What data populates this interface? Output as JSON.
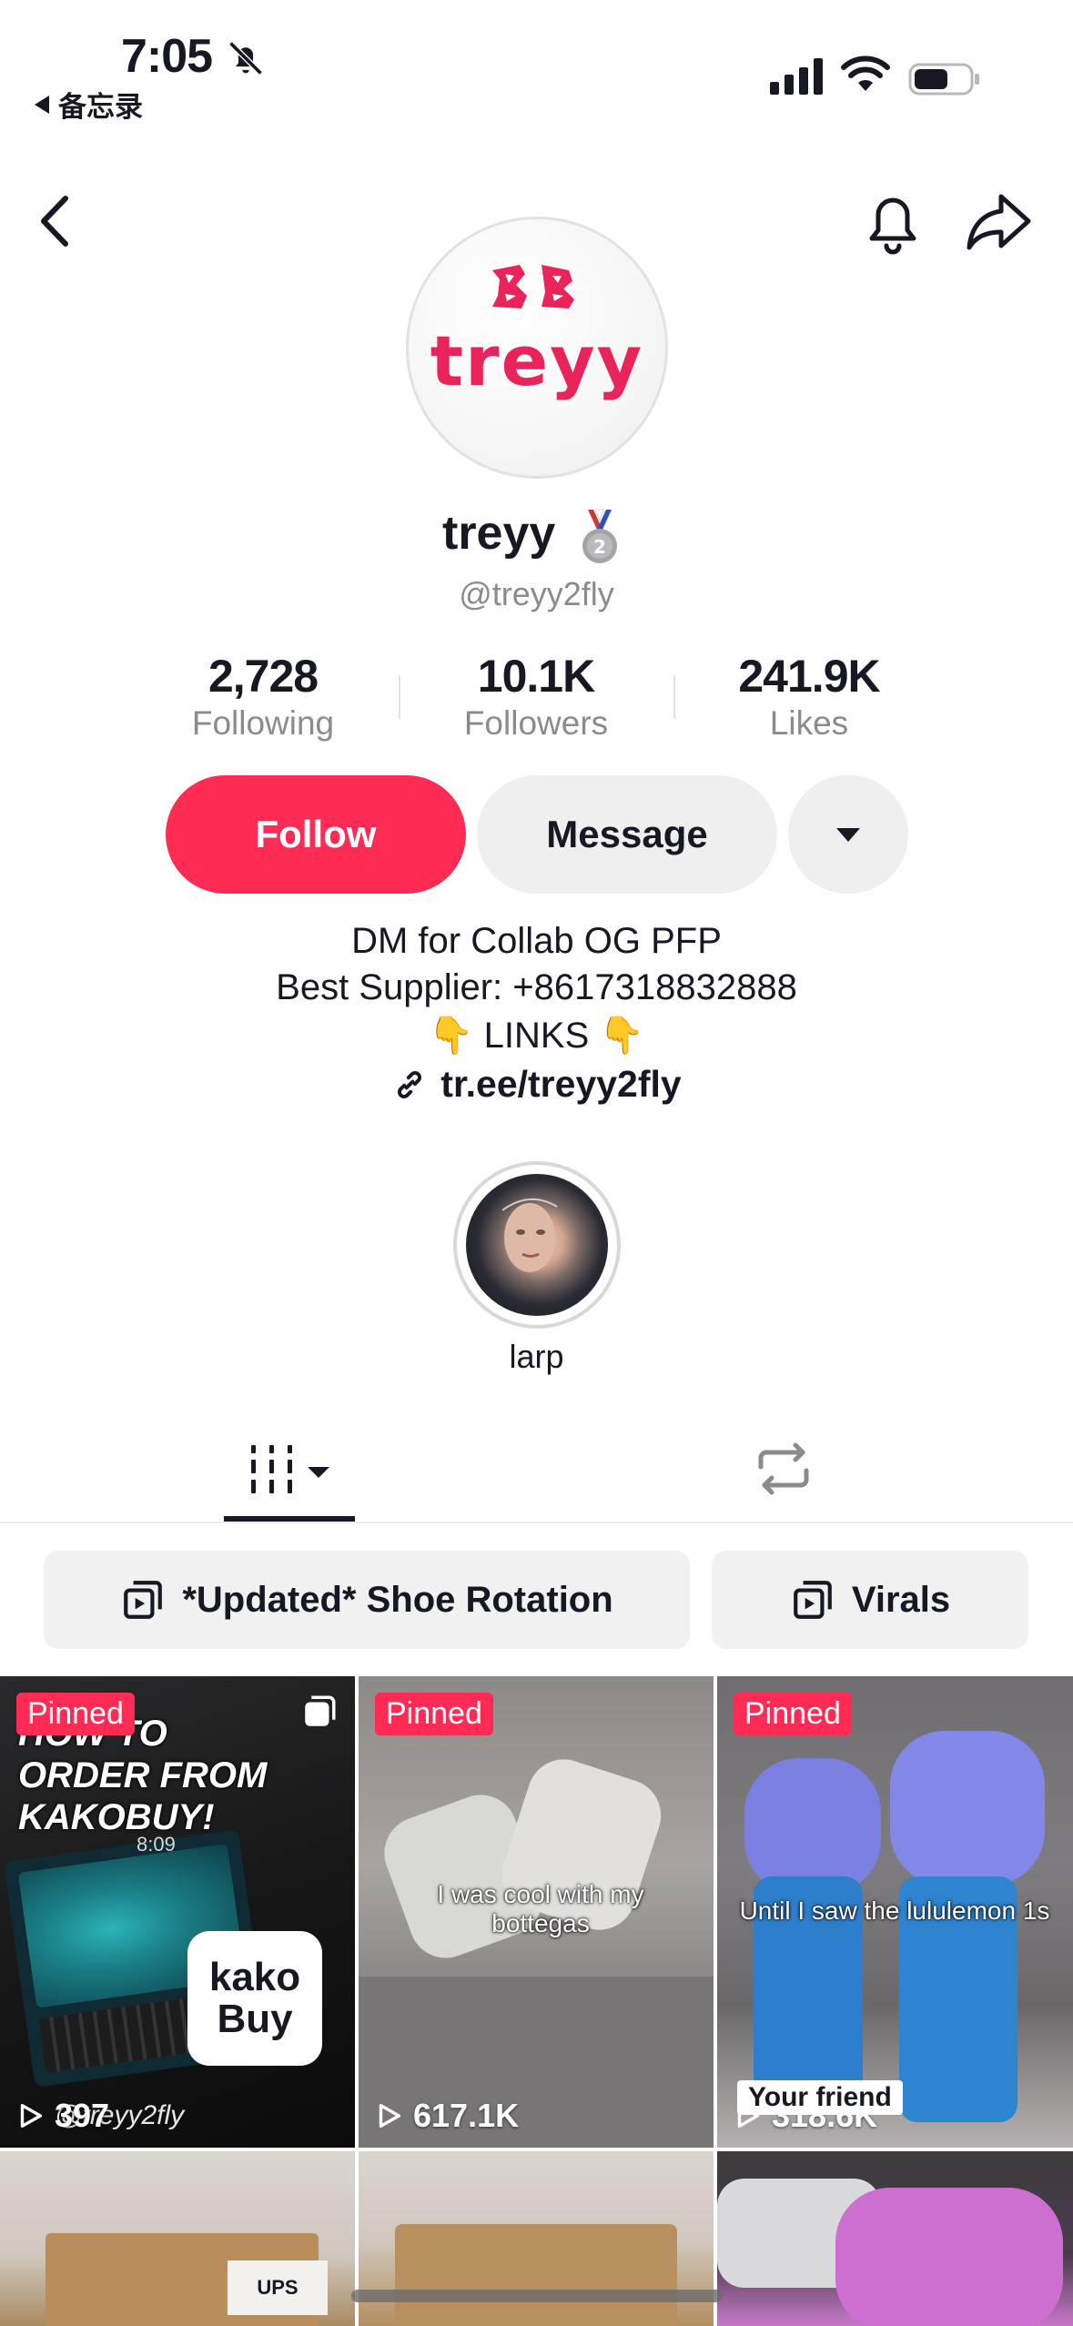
{
  "status_bar": {
    "time": "7:05",
    "back_app_label": "备忘录"
  },
  "nav": {
    "back_icon": "chevron-left-icon",
    "bell_icon": "bell-icon",
    "share_icon": "share-icon"
  },
  "profile": {
    "avatar_logo_text": "treyy",
    "display_name": "treyy",
    "badge_icon": "medal-icon",
    "handle": "@treyy2fly",
    "stats": [
      {
        "value": "2,728",
        "label": "Following"
      },
      {
        "value": "10.1K",
        "label": "Followers"
      },
      {
        "value": "241.9K",
        "label": "Likes"
      }
    ],
    "buttons": {
      "follow": "Follow",
      "message": "Message"
    },
    "bio_lines": [
      "DM for Collab OG PFP",
      "Best Supplier: +8617318832888",
      "👇 LINKS 👇"
    ],
    "link": "tr.ee/treyy2fly",
    "highlight_label": "larp"
  },
  "tabs": {
    "active": "videos-grid",
    "items": [
      "grid-icon",
      "repost-icon"
    ]
  },
  "playlists": [
    {
      "label": "*Updated* Shoe Rotation"
    },
    {
      "label": "Virals"
    }
  ],
  "videos": [
    {
      "badge": "Pinned",
      "views": "397",
      "caption": "HOW TO ORDER FROM KAKOBUY!",
      "watermark": "@treyy2fly",
      "brand": "kako Buy",
      "screen_time": "8:09"
    },
    {
      "badge": "Pinned",
      "views": "617.1K",
      "caption": "I was cool with my bottegas"
    },
    {
      "badge": "Pinned",
      "views": "318.6K",
      "caption": "Until I saw the lululemon 1s",
      "overlay": "Your friend"
    },
    {
      "views": "",
      "caption": ""
    },
    {
      "views": "",
      "caption": ""
    },
    {
      "views": "",
      "caption": ""
    }
  ],
  "colors": {
    "accent": "#fe2c55",
    "text": "#161823",
    "muted": "#8a8b91",
    "pill_bg": "#efeff0"
  }
}
